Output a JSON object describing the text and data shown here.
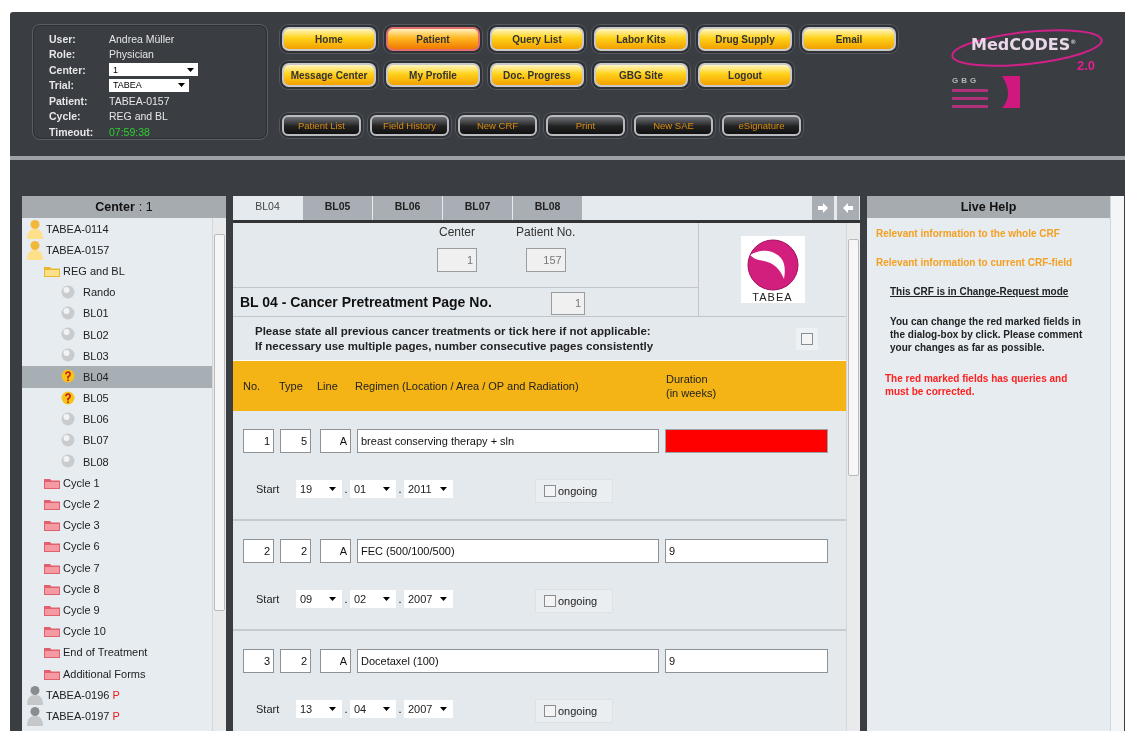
{
  "user_info": [
    {
      "label": "User:",
      "value": "Andrea Müller",
      "kind": "text"
    },
    {
      "label": "Role:",
      "value": "Physician",
      "kind": "text"
    },
    {
      "label": "Center:",
      "value": "1",
      "kind": "select"
    },
    {
      "label": "Trial:",
      "value": "TABEA",
      "kind": "select"
    },
    {
      "label": "Patient:",
      "value": "TABEA-0157",
      "kind": "text"
    },
    {
      "label": "Cycle:",
      "value": "REG and BL",
      "kind": "text"
    },
    {
      "label": "Timeout:",
      "value": "07:59:38",
      "kind": "timer"
    }
  ],
  "nav_buttons": [
    [
      {
        "label": "Home",
        "selected": false
      },
      {
        "label": "Patient",
        "selected": true
      },
      {
        "label": "Query List",
        "selected": false
      },
      {
        "label": "Labor Kits",
        "selected": false
      },
      {
        "label": "Drug Supply",
        "selected": false
      },
      {
        "label": "Email",
        "selected": false
      }
    ],
    [
      {
        "label": "Message Center",
        "selected": false
      },
      {
        "label": "My Profile",
        "selected": false
      },
      {
        "label": "Doc. Progress",
        "selected": false
      },
      {
        "label": "GBG Site",
        "selected": false
      },
      {
        "label": "Logout",
        "selected": false
      }
    ]
  ],
  "tool_buttons": [
    "Patient List",
    "Field History",
    "New CRF",
    "Print",
    "New SAE",
    "eSignature"
  ],
  "logo": {
    "name": "MedCODES",
    "mark": "®",
    "version": "2.0",
    "group": "GBG"
  },
  "tree": {
    "header_label": "Center",
    "header_value": ": 1",
    "items": [
      {
        "kind": "patient",
        "label": "TABEA-0114",
        "active": true,
        "selected": false
      },
      {
        "kind": "patient",
        "label": "TABEA-0157",
        "active": true,
        "selected": false,
        "children": [
          {
            "kind": "folder",
            "label": "REG and BL",
            "expanded": true,
            "selected": false,
            "children": [
              {
                "kind": "form",
                "label": "Rando",
                "query": false,
                "selected": false
              },
              {
                "kind": "form",
                "label": "BL01",
                "query": false,
                "selected": false
              },
              {
                "kind": "form",
                "label": "BL02",
                "query": false,
                "selected": false
              },
              {
                "kind": "form",
                "label": "BL03",
                "query": false,
                "selected": false
              },
              {
                "kind": "form",
                "label": "BL04",
                "query": true,
                "selected": true
              },
              {
                "kind": "form",
                "label": "BL05",
                "query": true,
                "selected": false
              },
              {
                "kind": "form",
                "label": "BL06",
                "query": false,
                "selected": false
              },
              {
                "kind": "form",
                "label": "BL07",
                "query": false,
                "selected": false
              },
              {
                "kind": "form",
                "label": "BL08",
                "query": false,
                "selected": false
              }
            ]
          },
          {
            "kind": "folder",
            "label": "Cycle 1",
            "expanded": false,
            "selected": false
          },
          {
            "kind": "folder",
            "label": "Cycle 2",
            "expanded": false,
            "selected": false
          },
          {
            "kind": "folder",
            "label": "Cycle 3",
            "expanded": false,
            "selected": false
          },
          {
            "kind": "folder",
            "label": "Cycle 6",
            "expanded": false,
            "selected": false
          },
          {
            "kind": "folder",
            "label": "Cycle 7",
            "expanded": false,
            "selected": false
          },
          {
            "kind": "folder",
            "label": "Cycle 8",
            "expanded": false,
            "selected": false
          },
          {
            "kind": "folder",
            "label": "Cycle 9",
            "expanded": false,
            "selected": false
          },
          {
            "kind": "folder",
            "label": "Cycle 10",
            "expanded": false,
            "selected": false
          },
          {
            "kind": "folder",
            "label": "End of Treatment",
            "expanded": false,
            "selected": false
          },
          {
            "kind": "folder",
            "label": "Additional Forms",
            "expanded": false,
            "selected": false
          }
        ]
      },
      {
        "kind": "patient",
        "label": "TABEA-0196",
        "active": false,
        "flag": "P",
        "selected": false
      },
      {
        "kind": "patient",
        "label": "TABEA-0197",
        "active": false,
        "flag": "P",
        "selected": false
      }
    ]
  },
  "tabs": [
    {
      "label": "BL04",
      "selected": true
    },
    {
      "label": "BL05",
      "selected": false
    },
    {
      "label": "BL06",
      "selected": false
    },
    {
      "label": "BL07",
      "selected": false
    },
    {
      "label": "BL08",
      "selected": false
    }
  ],
  "form": {
    "center_label": "Center",
    "center_value": "1",
    "patient_label": "Patient No.",
    "patient_value": "157",
    "title": "BL 04 - Cancer Pretreatment Page No.",
    "page_no": "1",
    "trial_logo": "TABEA",
    "instructions": [
      "Please state all previous cancer treatments or tick here if not applicable:",
      "If necessary use multiple pages, number consecutive pages consistently"
    ],
    "not_applicable": false,
    "columns": [
      "No.",
      "Type",
      "Line",
      "Regimen (Location / Area / OP and Radiation)",
      [
        "Duration",
        "(in weeks)"
      ]
    ],
    "rows": [
      {
        "no": "1",
        "type": "5",
        "line": "A",
        "regimen": "breast conserving therapy + sln",
        "duration": "",
        "query": true,
        "start_label": "Start",
        "date_separator": ".",
        "day": "19",
        "month": "01",
        "year": "2011",
        "ongoing_label": "ongoing",
        "ongoing": false
      },
      {
        "no": "2",
        "type": "2",
        "line": "A",
        "regimen": "FEC (500/100/500)",
        "duration": "9",
        "query": false,
        "start_label": "Start",
        "date_separator": ".",
        "day": "09",
        "month": "02",
        "year": "2007",
        "ongoing_label": "ongoing",
        "ongoing": false
      },
      {
        "no": "3",
        "type": "2",
        "line": "A",
        "regimen": "Docetaxel (100)",
        "duration": "9",
        "query": false,
        "start_label": "Start",
        "date_separator": ".",
        "day": "13",
        "month": "04",
        "year": "2007",
        "ongoing_label": "ongoing",
        "ongoing": false
      }
    ]
  },
  "live_help": {
    "title": "Live Help",
    "texts": [
      {
        "kind": "info",
        "text": "Relevant information to the whole CRF"
      },
      {
        "kind": "info",
        "text": "Relevant information to current CRF-field"
      },
      {
        "kind": "heading",
        "text": "This CRF is in Change-Request mode"
      },
      {
        "kind": "note",
        "text": "You can change the red marked fields in the dialog-box by click. Please comment your changes as far as possible."
      },
      {
        "kind": "alert",
        "text": "The red marked fields has queries and must be corrected."
      }
    ]
  }
}
